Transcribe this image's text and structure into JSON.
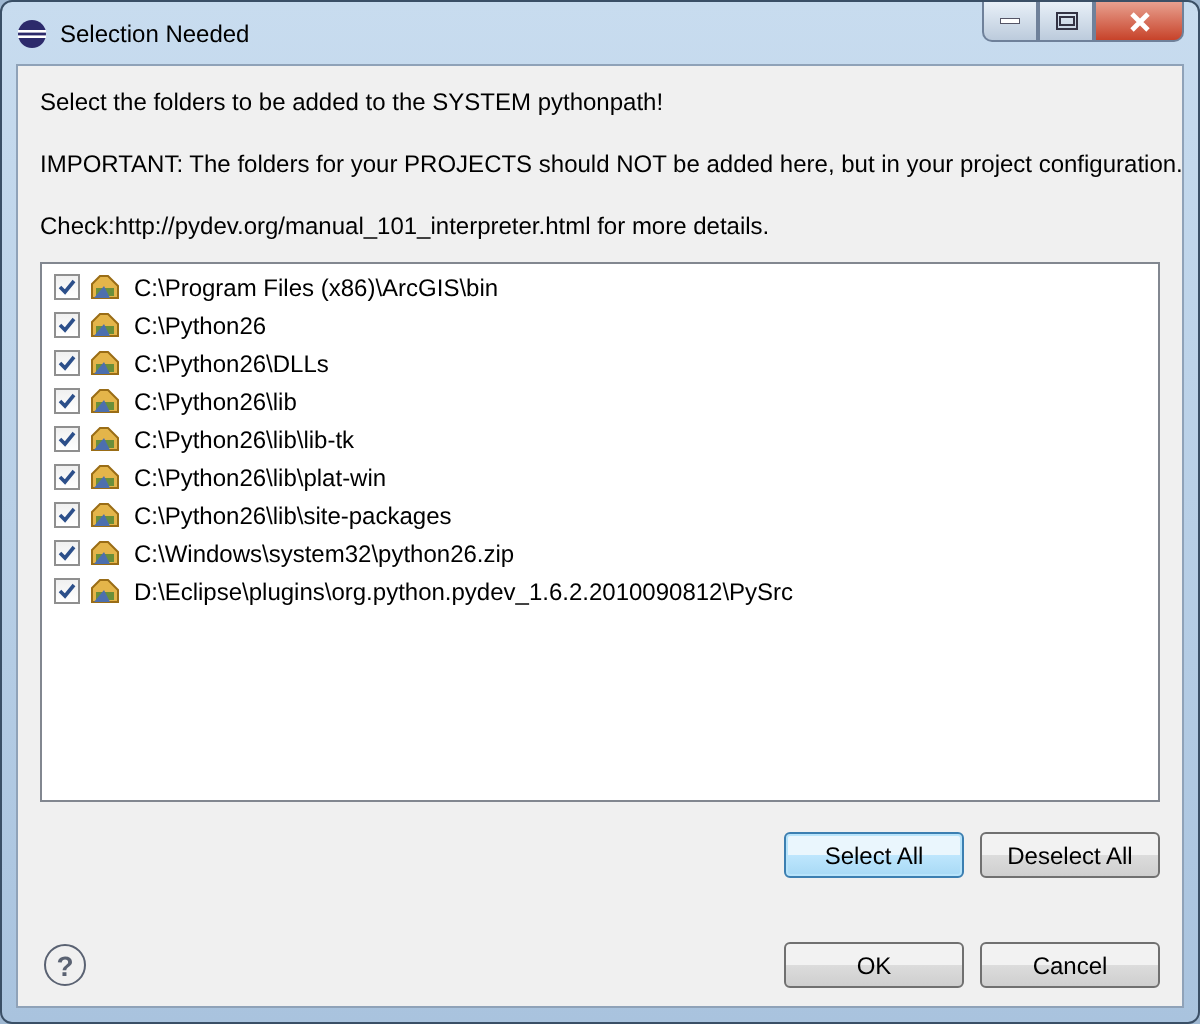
{
  "window": {
    "title": "Selection Needed"
  },
  "messages": [
    "Select the folders to be added to the SYSTEM pythonpath!",
    "IMPORTANT: The folders for your PROJECTS should NOT be added here, but in your project configuration.",
    "Check:http://pydev.org/manual_101_interpreter.html for more details."
  ],
  "folders": [
    {
      "path": "C:\\Program Files (x86)\\ArcGIS\\bin",
      "checked": true
    },
    {
      "path": "C:\\Python26",
      "checked": true
    },
    {
      "path": "C:\\Python26\\DLLs",
      "checked": true
    },
    {
      "path": "C:\\Python26\\lib",
      "checked": true
    },
    {
      "path": "C:\\Python26\\lib\\lib-tk",
      "checked": true
    },
    {
      "path": "C:\\Python26\\lib\\plat-win",
      "checked": true
    },
    {
      "path": "C:\\Python26\\lib\\site-packages",
      "checked": true
    },
    {
      "path": "C:\\Windows\\system32\\python26.zip",
      "checked": true
    },
    {
      "path": "D:\\Eclipse\\plugins\\org.python.pydev_1.6.2.2010090812\\PySrc",
      "checked": true
    }
  ],
  "list_buttons": [
    {
      "label": "Select All",
      "selected": true
    },
    {
      "label": "Deselect All",
      "selected": false
    }
  ],
  "help": "?",
  "buttons": [
    {
      "label": "OK",
      "selected": false
    },
    {
      "label": "Cancel",
      "selected": false
    }
  ]
}
